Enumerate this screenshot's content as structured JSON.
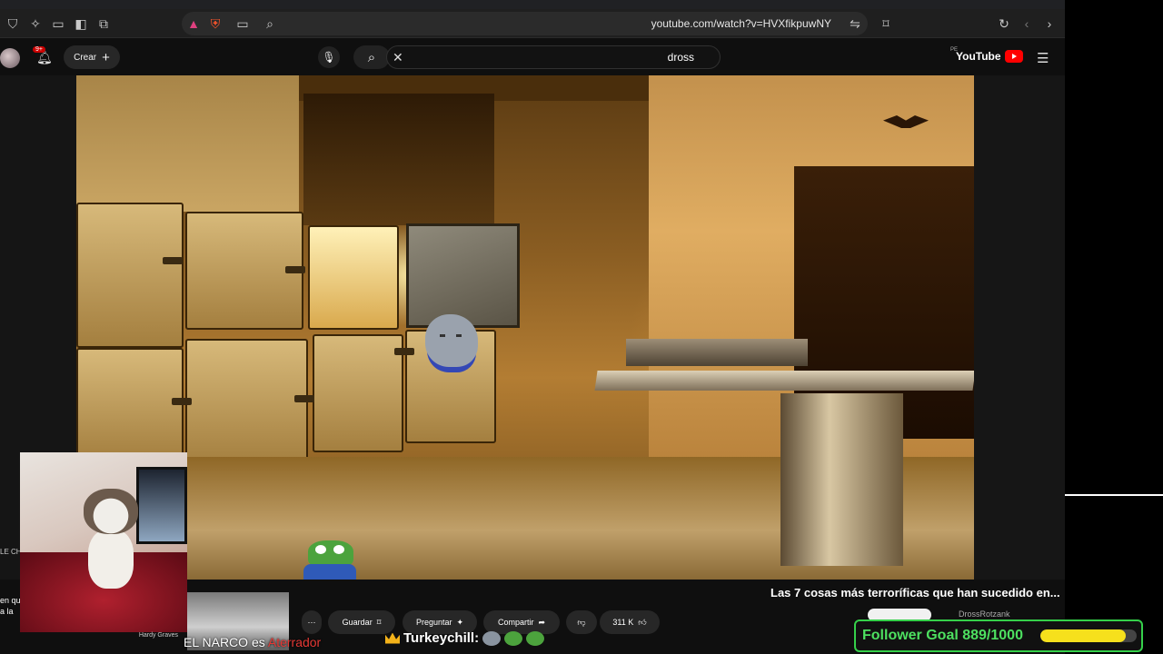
{
  "browser": {
    "url": "youtube.com/watch?v=HVXfikpuwNY"
  },
  "youtube": {
    "logo_text": "YouTube",
    "region": "PE",
    "search_query": "dross",
    "create_label": "Crear",
    "notifications_badge": "9+"
  },
  "video": {
    "title": "Las 7 cosas más terroríficas que han sucedido en...",
    "channel_name": "DrossRotzank",
    "likes": "311 K",
    "share_label": "Compartir",
    "ask_label": "Preguntar",
    "save_label": "Guardar"
  },
  "overlay": {
    "chat_user": "Turkeychill:",
    "narco_text_white": "EL NARCO es ",
    "narco_text_red": "Aterrador",
    "cam2_caption": "Hardy Graves",
    "left_fragment_1": "en que",
    "left_fragment_2": "a la",
    "left_fragment_small": "LE CH"
  },
  "follower_goal": {
    "label": "Follower Goal 889/1000",
    "current": 889,
    "target": 1000,
    "fill_color": "#f6e01c",
    "border_color": "#35d04a"
  },
  "colors": {
    "yt_red": "#ff0000",
    "goal_text": "#4de060",
    "narco_red": "#e53935"
  }
}
